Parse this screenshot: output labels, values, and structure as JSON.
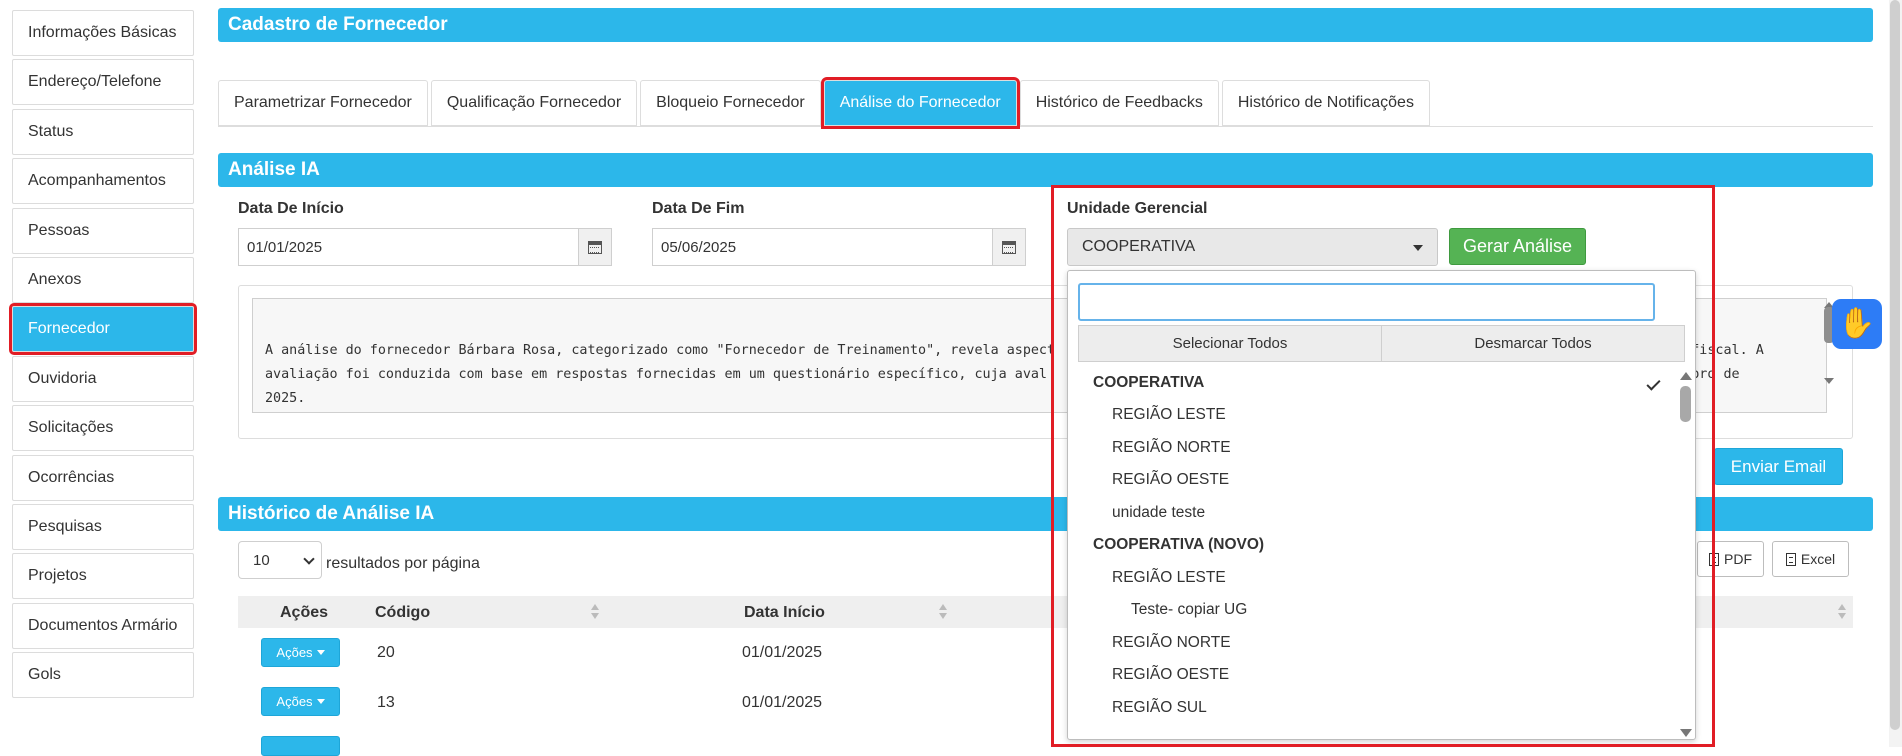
{
  "sidebar": {
    "items": [
      {
        "label": "Informações Básicas"
      },
      {
        "label": "Endereço/Telefone"
      },
      {
        "label": "Status"
      },
      {
        "label": "Acompanhamentos"
      },
      {
        "label": "Pessoas"
      },
      {
        "label": "Anexos"
      },
      {
        "label": "Fornecedor",
        "active": true
      },
      {
        "label": "Ouvidoria"
      },
      {
        "label": "Solicitações"
      },
      {
        "label": "Ocorrências"
      },
      {
        "label": "Pesquisas"
      },
      {
        "label": "Projetos"
      },
      {
        "label": "Documentos Armário"
      },
      {
        "label": "Gols"
      }
    ]
  },
  "header": {
    "title": "Cadastro de Fornecedor"
  },
  "tabs": [
    {
      "label": "Parametrizar Fornecedor"
    },
    {
      "label": "Qualificação Fornecedor"
    },
    {
      "label": "Bloqueio Fornecedor"
    },
    {
      "label": "Análise do Fornecedor",
      "active": true
    },
    {
      "label": "Histórico de Feedbacks"
    },
    {
      "label": "Histórico de Notificações"
    }
  ],
  "analysis": {
    "section_title": "Análise IA",
    "start_date_label": "Data De Início",
    "start_date_value": "01/01/2025",
    "end_date_label": "Data De Fim",
    "end_date_value": "05/06/2025",
    "unit_label": "Unidade Gerencial",
    "unit_selected": "COOPERATIVA",
    "generate_button": "Gerar Análise",
    "text_line1_start": "A análise do fornecedor Bárbara Rosa, categorizado como \"Fornecedor de Treinamento\", revela aspect",
    "text_line1_end": "ão fiscal. A",
    "text_line2_start": "avaliação foi conduzida com base em respostas fornecidas em um questionário específico, cuja aval",
    "text_line2_end": "ovembro de",
    "text_line3": "2025.",
    "email_button": "Enviar Email"
  },
  "dropdown": {
    "search_placeholder": "",
    "select_all": "Selecionar Todos",
    "deselect_all": "Desmarcar Todos",
    "options": [
      {
        "label": "COOPERATIVA",
        "level": 0,
        "selected": true
      },
      {
        "label": "REGIÃO LESTE",
        "level": 1
      },
      {
        "label": "REGIÃO NORTE",
        "level": 1
      },
      {
        "label": "REGIÃO OESTE",
        "level": 1
      },
      {
        "label": "unidade teste",
        "level": 1
      },
      {
        "label": "COOPERATIVA (NOVO)",
        "level": 0
      },
      {
        "label": "REGIÃO LESTE",
        "level": 1
      },
      {
        "label": "Teste- copiar UG",
        "level": 2
      },
      {
        "label": "REGIÃO NORTE",
        "level": 1
      },
      {
        "label": "REGIÃO OESTE",
        "level": 1
      },
      {
        "label": "REGIÃO SUL",
        "level": 1
      }
    ]
  },
  "history": {
    "section_title": "Histórico de Análise IA",
    "page_size": "10",
    "page_size_suffix": "resultados por página",
    "pdf_button": "PDF",
    "excel_button": "Excel",
    "columns": [
      "Ações",
      "Código",
      "Data Início"
    ],
    "actions_label": "Ações",
    "rows": [
      {
        "code": "20",
        "start": "01/01/2025"
      },
      {
        "code": "13",
        "start": "01/01/2025"
      }
    ]
  },
  "colors": {
    "primary": "#2cb7ea",
    "success": "#55b354",
    "highlight": "#e11d25",
    "a11y": "#2d7cf6"
  },
  "icons": [
    "calendar-icon",
    "chevron-down-icon",
    "check-icon",
    "pdf-icon",
    "excel-icon",
    "sign-language-icon"
  ]
}
